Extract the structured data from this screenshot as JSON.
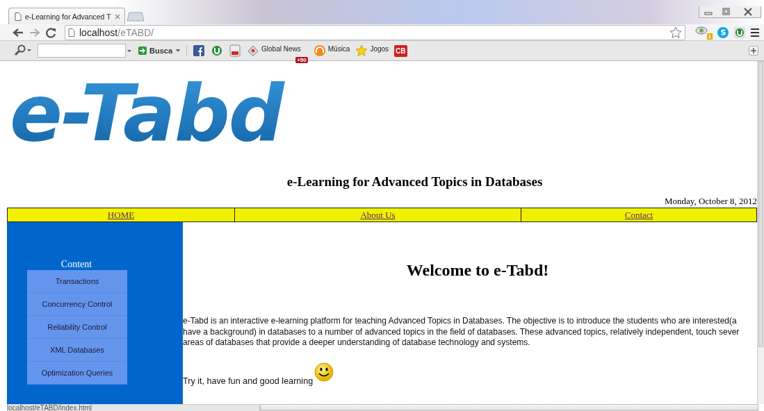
{
  "browser": {
    "tab_title": "e-Learning for Advanced T",
    "address_host": "localhost",
    "address_path": "/eTABD/",
    "search_button": "Busca",
    "bookmarks": [
      {
        "kind": "facebook"
      },
      {
        "kind": "torrent"
      },
      {
        "kind": "video"
      },
      {
        "kind": "news",
        "label": "Global News",
        "badge": "+50"
      },
      {
        "kind": "music",
        "label": "Música"
      },
      {
        "kind": "star",
        "label": "Jogos"
      },
      {
        "kind": "logo",
        "label": "CB"
      }
    ],
    "extension_badge": "1"
  },
  "page": {
    "logo": "e-Tabd",
    "subtitle": "e-Learning for Advanced Topics in Databases",
    "date": "Monday, October 8, 2012",
    "nav": [
      {
        "label": "HOME"
      },
      {
        "label": "About Us"
      },
      {
        "label": "Contact"
      }
    ],
    "sidebar": {
      "title": "Content",
      "items": [
        {
          "label": "Transactions"
        },
        {
          "label": "Concurrency Control"
        },
        {
          "label": "Reliability Control"
        },
        {
          "label": "XML Databases"
        },
        {
          "label": "Optimization Queries"
        }
      ]
    },
    "heading": "Welcome to e-Tabd!",
    "paragraph": "e-Tabd is an interactive e-learning platform for teaching Advanced Topics in Databases. The objective is to introduce the students who are interested(a\nhave a background) in databases to a number of advanced topics in the field of databases. These advanced topics, relatively independent, touch sever\nareas of databases that provide a deeper understanding of database technology and systems.",
    "closing": "Try it, have fun and good learning"
  },
  "status_bar": {
    "url": "localhost/eTABD/index.html"
  }
}
